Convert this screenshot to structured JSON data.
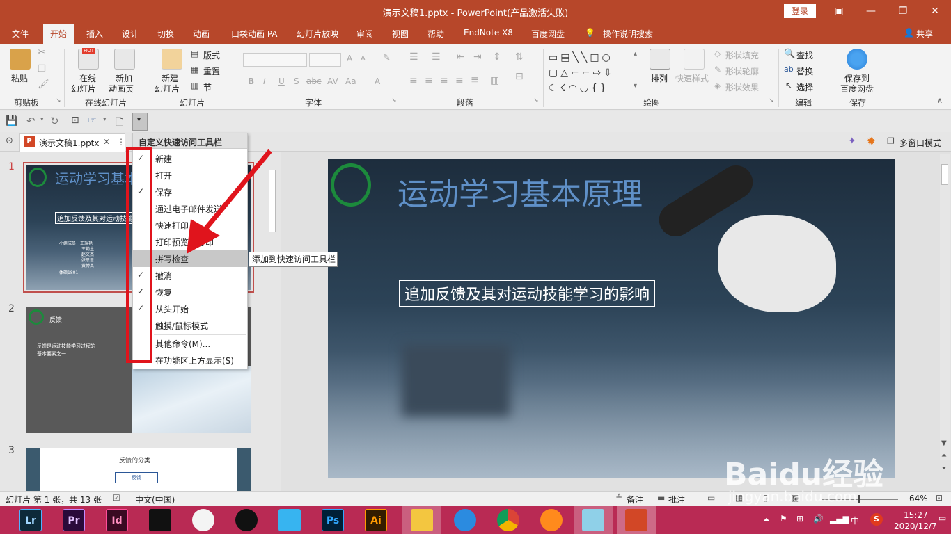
{
  "window": {
    "title": "演示文稿1.pptx  -  PowerPoint(产品激活失败)",
    "login": "登录",
    "min": "—",
    "max": "❐",
    "close": "✕",
    "restore": "▣"
  },
  "tabs": [
    "文件",
    "开始",
    "插入",
    "设计",
    "切换",
    "动画",
    "口袋动画 PA",
    "幻灯片放映",
    "审阅",
    "视图",
    "帮助",
    "EndNote X8",
    "百度网盘",
    "操作说明搜索"
  ],
  "share": "共享",
  "ribbon": {
    "clipboard": {
      "paste": "粘贴",
      "group": "剪贴板"
    },
    "online": {
      "new_online": "在线",
      "new_online2": "幻灯片",
      "new_anim": "新加",
      "new_anim2": "动画页",
      "hot": "HOT",
      "group": "在线幻灯片"
    },
    "slides": {
      "new": "新建",
      "new2": "幻灯片",
      "layout": "版式",
      "reset": "重置",
      "section": "节",
      "group": "幻灯片"
    },
    "font": {
      "group": "字体",
      "bold": "B",
      "italic": "I",
      "underline": "U",
      "strike": "S",
      "shadow": "abc",
      "spacing": "AV",
      "case": "Aa",
      "grow": "A",
      "shrink": "A",
      "color": "A"
    },
    "paragraph": {
      "group": "段落"
    },
    "drawing": {
      "arrange": "排列",
      "quick_styles": "快速样式",
      "fill": "形状填充",
      "outline": "形状轮廓",
      "effects": "形状效果",
      "group": "绘图"
    },
    "editing": {
      "find": "查找",
      "replace": "替换",
      "select": "选择",
      "group": "编辑"
    },
    "save": {
      "line1": "保存到",
      "line2": "百度网盘",
      "group": "保存"
    }
  },
  "file_tab": {
    "name": "演示文稿1.pptx",
    "close": "✕",
    "more": "⋮"
  },
  "multi_window": "多窗口模式",
  "menu": {
    "title": "自定义快速访问工具栏",
    "items": [
      {
        "label": "新建",
        "checked": "✓"
      },
      {
        "label": "打开",
        "checked": ""
      },
      {
        "label": "保存",
        "checked": "✓"
      },
      {
        "label": "通过电子邮件发送",
        "checked": ""
      },
      {
        "label": "快速打印",
        "checked": ""
      },
      {
        "label": "打印预览和打印",
        "checked": ""
      },
      {
        "label": "拼写检查",
        "checked": ""
      },
      {
        "label": "撤消",
        "checked": "✓"
      },
      {
        "label": "恢复",
        "checked": "✓"
      },
      {
        "label": "从头开始",
        "checked": "✓"
      },
      {
        "label": "触摸/鼠标模式",
        "checked": ""
      },
      {
        "label": "其他命令(M)...",
        "checked": ""
      },
      {
        "label": "在功能区上方显示(S)",
        "checked": ""
      }
    ]
  },
  "tooltip": "添加到快速访问工具栏",
  "slides": [
    {
      "num": "1",
      "title": "运动学习基本原理",
      "subtitle": "追加反馈及其对运动技能学习的影响",
      "members": [
        "小组成员：王瑞艳",
        "王莉生",
        "赵文杰",
        "张思思",
        "黄博真",
        "体硕1801"
      ]
    },
    {
      "num": "2",
      "title": "反馈",
      "body": "反馈是运动技能学习过程的基本要素之一"
    },
    {
      "num": "3",
      "title": "反馈的分类",
      "box": "反馈"
    }
  ],
  "main_slide": {
    "title": "运动学习基本原理",
    "subtitle": "追加反馈及其对运动技能学习的影响"
  },
  "status": {
    "slide_info": "幻灯片 第 1 张，共 13 张",
    "lang": "中文(中国)",
    "notes": "备注",
    "comments": "批注",
    "zoom": "64%"
  },
  "watermark": {
    "brand": "Baidu经验",
    "url": "jingyan.baidu.com"
  },
  "taskbar": {
    "apps": [
      "Lr",
      "Pr",
      "Id",
      "",
      "",
      "",
      "",
      "Ps",
      "Ai",
      "",
      "",
      "",
      "",
      "",
      ""
    ],
    "time": "15:27",
    "date": "2020/12/7",
    "ime": "中"
  }
}
